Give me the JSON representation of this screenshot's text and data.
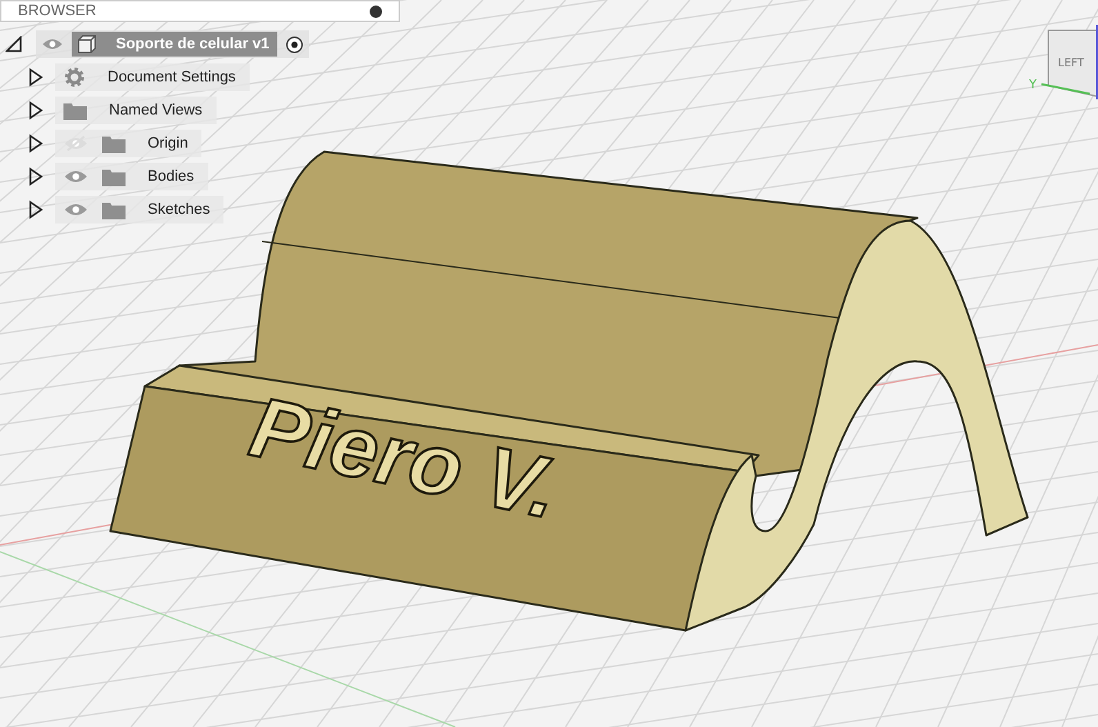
{
  "browser": {
    "title": "BROWSER",
    "root": {
      "label": "Soporte de celular v1",
      "expanded": true,
      "visible": true,
      "active": true,
      "children": [
        {
          "kind": "settings",
          "label": "Document Settings",
          "expanded": false
        },
        {
          "kind": "folder",
          "label": "Named Views",
          "expanded": false
        },
        {
          "kind": "folder",
          "label": "Origin",
          "expanded": false,
          "visible": false
        },
        {
          "kind": "folder",
          "label": "Bodies",
          "expanded": false,
          "visible": true
        },
        {
          "kind": "folder",
          "label": "Sketches",
          "expanded": false,
          "visible": true
        }
      ]
    }
  },
  "viewport": {
    "model_text": "Piero V.",
    "view_cube": {
      "face": "LEFT",
      "axis": "Y"
    }
  }
}
